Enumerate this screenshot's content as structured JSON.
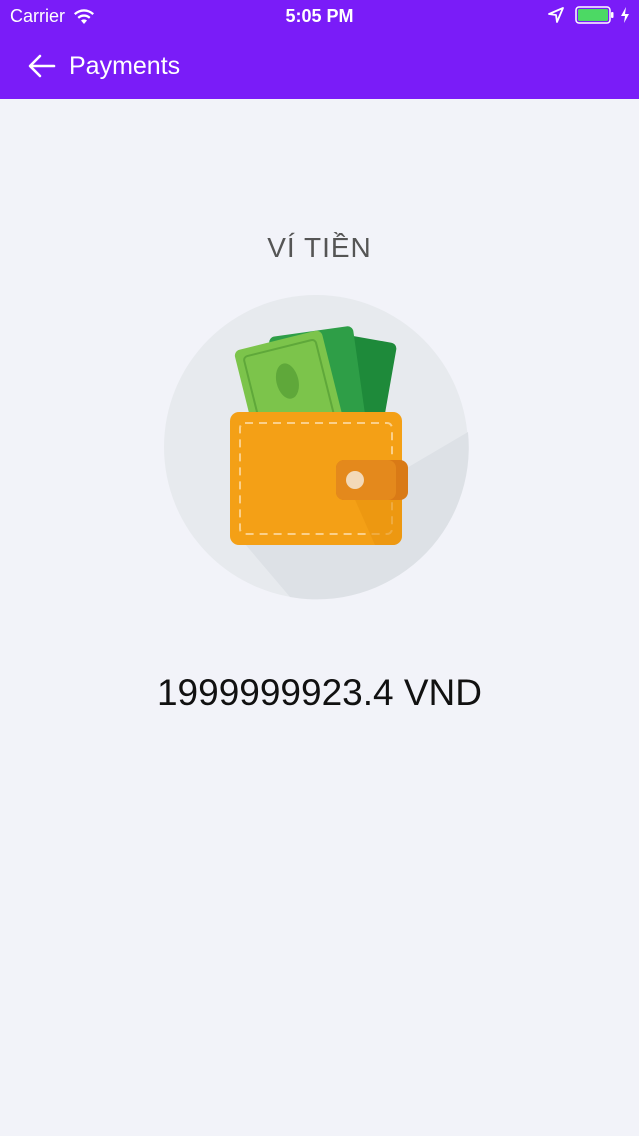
{
  "status_bar": {
    "carrier": "Carrier",
    "time": "5:05 PM",
    "icons": [
      "wifi-icon",
      "location-icon",
      "battery-icon",
      "charging-icon"
    ]
  },
  "nav": {
    "back_icon": "arrow-left-icon",
    "title": "Payments"
  },
  "wallet": {
    "title": "VÍ TIỀN",
    "illustration": "wallet-with-cash-icon",
    "balance": "1999999923.4 VND"
  },
  "colors": {
    "header": "#7a1cf8",
    "background": "#f2f3f9",
    "wallet_orange": "#f4a016",
    "cash_green": "#7cc44b"
  }
}
